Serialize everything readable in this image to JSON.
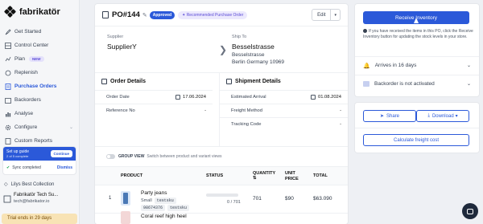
{
  "brand": {
    "name": "fabrikatör"
  },
  "sidebar": {
    "items": [
      {
        "label": "Get Started"
      },
      {
        "label": "Control Center"
      },
      {
        "label": "Plan",
        "badge": "NEW"
      },
      {
        "label": "Replenish"
      },
      {
        "label": "Purchase Orders"
      },
      {
        "label": "Backorders"
      },
      {
        "label": "Analyse"
      },
      {
        "label": "Configure"
      },
      {
        "label": "Custom Reports"
      }
    ],
    "setup": {
      "title": "Set up guide",
      "subtitle": "2 of 5 complete",
      "continue": "Continue",
      "sync": "Sync completed",
      "dismiss": "Dismiss"
    },
    "collection": "Lilys Best Collection",
    "user": {
      "name": "Fabrikatör Tech Su...",
      "email": "tech@fabrikator.io"
    },
    "trial": "Trial ends in 29 days"
  },
  "po": {
    "number": "PO#144",
    "status": "Approved",
    "tag": "Recommended Purchase Order",
    "edit": "Edit",
    "supplier_label": "Supplier",
    "supplier": "SupplierY",
    "shipto_label": "Ship To",
    "shipto_name": "Besselstrasse",
    "shipto_line1": "Besselstrasse",
    "shipto_line2": "Berlin Germany 10969"
  },
  "order_details": {
    "title": "Order Details",
    "rows": [
      {
        "label": "Order Date",
        "value": "17.06.2024"
      },
      {
        "label": "Reference No",
        "value": "-"
      }
    ]
  },
  "shipment_details": {
    "title": "Shipment Details",
    "rows": [
      {
        "label": "Estimated Arrival",
        "value": "01.08.2024"
      },
      {
        "label": "Freight Method",
        "value": "-"
      },
      {
        "label": "Tracking Code",
        "value": "-"
      }
    ]
  },
  "group_view": {
    "label": "GROUP VIEW",
    "desc": "Switch between product and variant views"
  },
  "table": {
    "headers": {
      "product": "PRODUCT",
      "status": "STATUS",
      "quantity": "QUANTITY",
      "unit_price": "UNIT PRICE",
      "total": "TOTAL"
    },
    "rows": [
      {
        "index": "1",
        "name": "Party jeans",
        "variant": "Small",
        "sku": "testsku",
        "barcode": "98674376",
        "sku2": "testsku",
        "progress": "0 / 701",
        "progress_fraction": 0,
        "quantity": "701",
        "unit_price": "$90",
        "total": "$63.090"
      }
    ],
    "next_row": "Coral reef high heel"
  },
  "actions": {
    "receive": "Receive Inventory",
    "info": "If you have received the items in this PO, click the Receive Inventory button for updating the stock levels in your store.",
    "arrival": "Arrives in 16 days",
    "backorder": "Backorder is not activated",
    "share": "Share",
    "download": "Download",
    "freight": "Calculate freight cost"
  }
}
